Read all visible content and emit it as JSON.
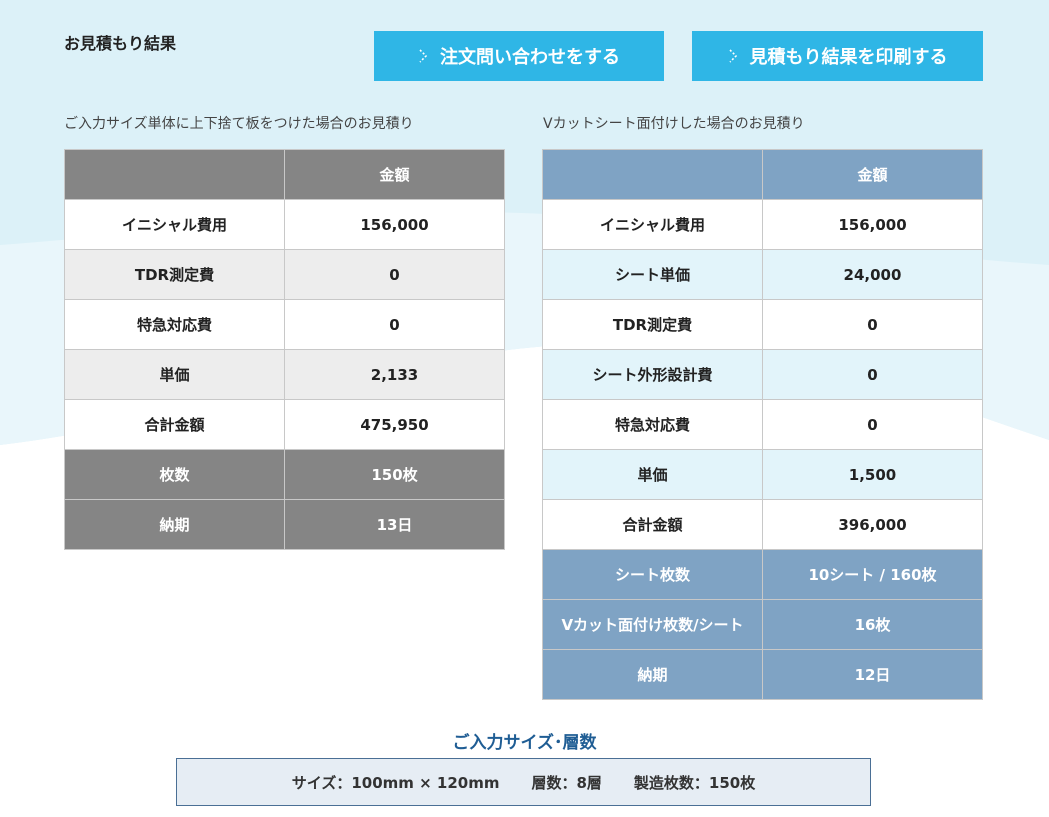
{
  "page_title": "お見積もり結果",
  "buttons": {
    "order": "注文問い合わせをする",
    "print": "見積もり結果を印刷する"
  },
  "left": {
    "caption": "ご入力サイズ単体に上下捨て板をつけた場合のお見積り",
    "header": "金額",
    "rows": [
      {
        "label": "イニシャル費用",
        "value": "156,000"
      },
      {
        "label": "TDR測定費",
        "value": "0"
      },
      {
        "label": "特急対応費",
        "value": "0"
      },
      {
        "label": "単価",
        "value": "2,133"
      },
      {
        "label": "合計金額",
        "value": "475,950"
      },
      {
        "label": "枚数",
        "value": "150枚"
      },
      {
        "label": "納期",
        "value": "13日"
      }
    ]
  },
  "right": {
    "caption": "Vカットシート面付けした場合のお見積り",
    "header": "金額",
    "rows": [
      {
        "label": "イニシャル費用",
        "value": "156,000"
      },
      {
        "label": "シート単価",
        "value": "24,000"
      },
      {
        "label": "TDR測定費",
        "value": "0"
      },
      {
        "label": "シート外形設計費",
        "value": "0"
      },
      {
        "label": "特急対応費",
        "value": "0"
      },
      {
        "label": "単価",
        "value": "1,500"
      },
      {
        "label": "合計金額",
        "value": "396,000"
      },
      {
        "label": "シート枚数",
        "value": "10シート / 160枚"
      },
      {
        "label": "Vカット面付け枚数/シート",
        "value": "16枚"
      },
      {
        "label": "納期",
        "value": "12日"
      }
    ]
  },
  "size_section": {
    "title": "ご入力サイズ･層数",
    "size": "サイズ：100mm × 120mm",
    "layers": "層数：8層",
    "count": "製造枚数：150枚"
  },
  "colors": {
    "button": "#2fb6e6",
    "left_header": "#858585",
    "right_header": "#7fa3c4",
    "right_stripe": "#e2f4fa",
    "background_tint": "#dcf1f8"
  }
}
